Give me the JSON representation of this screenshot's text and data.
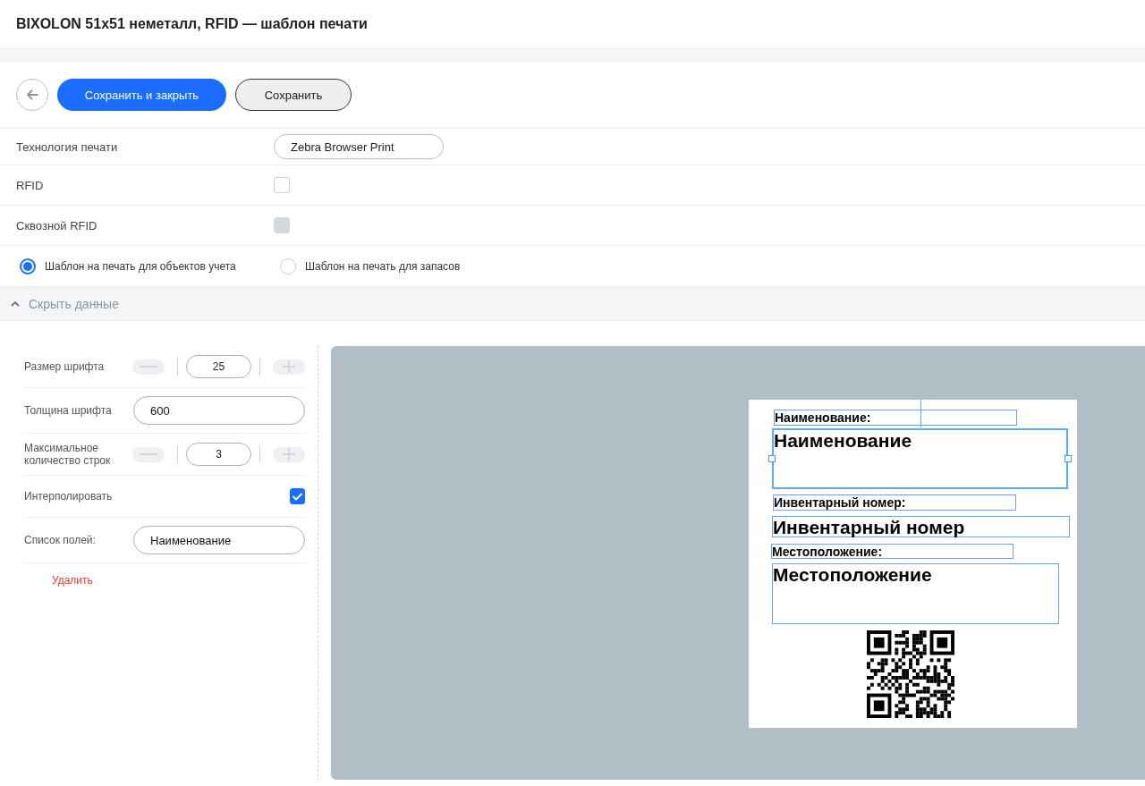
{
  "header": {
    "title": "BIXOLON 51x51 неметалл, RFID — шаблон печати"
  },
  "toolbar": {
    "buttons": [
      {
        "kind": "back"
      },
      {
        "kind": "primary",
        "label": "Сохранить и закрыть"
      },
      {
        "kind": "secondary",
        "label": "Сохранить"
      }
    ]
  },
  "settings": [
    {
      "kind": "field",
      "label": "Технология печати",
      "value": "Zebra Browser Print"
    },
    {
      "kind": "checkbox",
      "label": "RFID",
      "checked": false,
      "disabled": false
    },
    {
      "kind": "checkbox",
      "label": "Сквозной RFID",
      "checked": false,
      "disabled": true
    }
  ],
  "template_type": [
    {
      "label": "Шаблон на печать для объектов учета",
      "selected": true
    },
    {
      "label": "Шаблон на печать для запасов",
      "selected": false
    }
  ],
  "collapse": {
    "label": "Скрыть данные",
    "expanded": true
  },
  "properties": [
    {
      "kind": "stepper",
      "label": "Размер шрифта",
      "value": "25"
    },
    {
      "kind": "field",
      "label": "Толщина шрифта",
      "value": "600"
    },
    {
      "kind": "stepper",
      "label": "Максимальное количество строк",
      "value": "3"
    },
    {
      "kind": "checkbox",
      "label": "Интерполировать",
      "checked": true
    },
    {
      "kind": "field",
      "label": "Список полей:",
      "value": "Наименование"
    }
  ],
  "delete_link": "Удалить",
  "label_preview": {
    "elements": [
      {
        "kind": "caption",
        "text": "Наименование:",
        "selected": false
      },
      {
        "kind": "value",
        "text": "Наименование",
        "selected": true
      },
      {
        "kind": "caption",
        "text": "Инвентарный номер:",
        "selected": false
      },
      {
        "kind": "value",
        "text": "Инвентарный номер",
        "selected": false
      },
      {
        "kind": "caption",
        "text": "Местоположение:",
        "selected": false
      },
      {
        "kind": "value",
        "text": "Местоположение",
        "selected": false
      }
    ]
  }
}
